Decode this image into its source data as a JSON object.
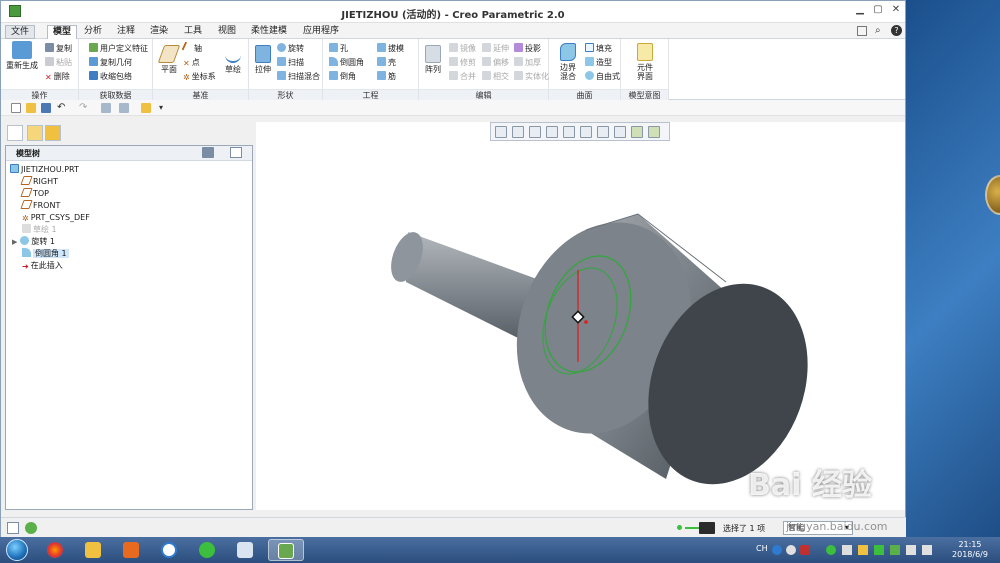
{
  "window": {
    "title": "JIETIZHOU (活动的) - Creo Parametric 2.0"
  },
  "menu_tabs": [
    {
      "label": "文件"
    },
    {
      "label": "模型"
    },
    {
      "label": "分析"
    },
    {
      "label": "注释"
    },
    {
      "label": "渲染"
    },
    {
      "label": "工具"
    },
    {
      "label": "视图"
    },
    {
      "label": "柔性建模"
    },
    {
      "label": "应用程序"
    }
  ],
  "ribbon": {
    "groups": [
      {
        "label": "操作"
      },
      {
        "label": "获取数据"
      },
      {
        "label": "基准"
      },
      {
        "label": "形状"
      },
      {
        "label": "工程"
      },
      {
        "label": "编辑"
      },
      {
        "label": "曲面"
      },
      {
        "label": "模型意图"
      }
    ],
    "ops": {
      "regen": "重新生成",
      "copy": "复制",
      "paste": "粘贴",
      "delete": "删除"
    },
    "getdata": {
      "udf": "用户定义特征",
      "copygeom": "复制几何",
      "shrinkwrap": "收缩包络"
    },
    "datum": {
      "plane": "平面",
      "axis": "轴",
      "point": "点",
      "csys": "坐标系",
      "sketch": "草绘"
    },
    "shape": {
      "extrude": "拉伸",
      "revolve": "旋转",
      "sweep": "扫描",
      "swept_blend": "扫描混合"
    },
    "eng": {
      "hole": "孔",
      "round": "倒圆角",
      "chamfer": "倒角",
      "draft": "拔模",
      "shell": "壳",
      "rib": "筋"
    },
    "edit": {
      "pattern": "阵列",
      "mirror": "镜像",
      "extend": "延伸",
      "project": "投影",
      "trim": "修剪",
      "offset": "偏移",
      "thicken": "加厚",
      "merge": "合并",
      "intersect": "相交",
      "solidify": "实体化"
    },
    "surface": {
      "boundary": "边界混合",
      "fill": "填充",
      "style": "造型",
      "freestyle": "自由式"
    },
    "intent": {
      "component": "元件界面"
    }
  },
  "model_tree": {
    "header": "模型树",
    "items": [
      {
        "label": "JIETIZHOU.PRT"
      },
      {
        "label": "RIGHT"
      },
      {
        "label": "TOP"
      },
      {
        "label": "FRONT"
      },
      {
        "label": "PRT_CSYS_DEF"
      },
      {
        "label": "草绘 1"
      },
      {
        "label": "旋转 1"
      },
      {
        "label": "倒圆角 1"
      },
      {
        "label": "在此插入"
      }
    ]
  },
  "status": {
    "selection": "选择了 1 项",
    "filter": "智能"
  },
  "taskbar": {
    "tray_lang": "CH",
    "time": "21:15",
    "date": "2018/6/9"
  },
  "watermark": {
    "brand": "Bai 经验",
    "url": "jingyan.baidu.com"
  },
  "colors": {
    "accent": "#2e7bd1",
    "part_gray": "#6f777f",
    "edge_green": "#2fa83a"
  }
}
